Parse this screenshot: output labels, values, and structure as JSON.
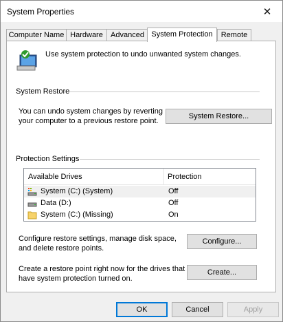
{
  "window": {
    "title": "System Properties",
    "close_glyph": "✕"
  },
  "tabs": [
    {
      "label": "Computer Name"
    },
    {
      "label": "Hardware"
    },
    {
      "label": "Advanced"
    },
    {
      "label": "System Protection",
      "active": true
    },
    {
      "label": "Remote"
    }
  ],
  "intro": {
    "text": "Use system protection to undo unwanted system changes.",
    "icon": "system-protection-icon"
  },
  "system_restore": {
    "heading": "System Restore",
    "description_line1": "You can undo system changes by reverting",
    "description_line2": "your computer to a previous restore point.",
    "button_label": "System Restore..."
  },
  "protection_settings": {
    "heading": "Protection Settings",
    "columns": [
      "Available Drives",
      "Protection"
    ],
    "drives": [
      {
        "name": "System (C:) (System)",
        "protection": "Off",
        "icon": "system-drive-icon",
        "selected": true
      },
      {
        "name": "Data (D:)",
        "protection": "Off",
        "icon": "drive-icon"
      },
      {
        "name": "System (C:) (Missing)",
        "protection": "On",
        "icon": "folder-icon"
      }
    ],
    "configure_line1": "Configure restore settings, manage disk space,",
    "configure_line2": "and delete restore points.",
    "configure_button": "Configure...",
    "create_line1": "Create a restore point right now for the drives that",
    "create_line2": "have system protection turned on.",
    "create_button": "Create..."
  },
  "footer": {
    "ok": "OK",
    "cancel": "Cancel",
    "apply": "Apply"
  },
  "colors": {
    "accent": "#0078d7",
    "panel": "#ffffff",
    "window": "#f0f0f0"
  }
}
